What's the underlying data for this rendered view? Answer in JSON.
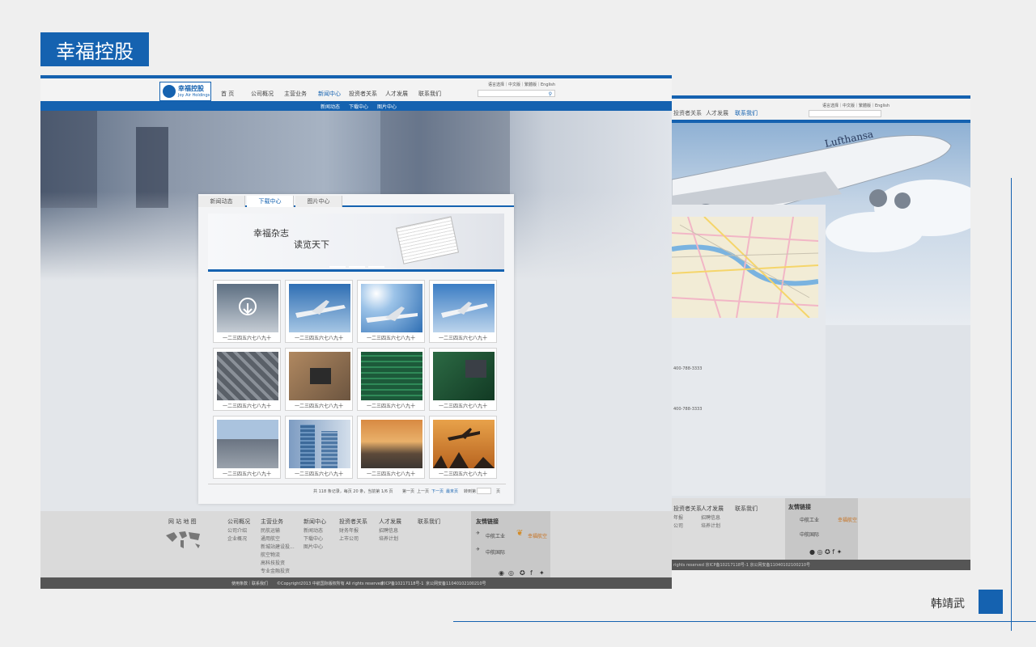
{
  "title": "幸福控股",
  "author": "韩靖武",
  "colors": {
    "accent": "#1562b0",
    "footer_dark": "#555555"
  },
  "front": {
    "logo": {
      "cn": "幸福控股",
      "en": "Joy Air Holdings"
    },
    "nav": [
      "首 页",
      "公司概况",
      "主营业务",
      "新闻中心",
      "投资者关系",
      "人才发展",
      "联系我们"
    ],
    "lang": "语言选择｜中文版｜繁體版｜English",
    "subnav": [
      "新闻动态",
      "下载中心",
      "图片中心"
    ],
    "tabs": [
      "新闻动态",
      "下载中心",
      "图片中心"
    ],
    "magazine": {
      "line1": "幸福杂志",
      "line2": "读览天下"
    },
    "cards": [
      "一二三四五六七八九十",
      "一二三四五六七八九十",
      "一二三四五六七八九十",
      "一二三四五六七八九十",
      "一二三四五六七八九十",
      "一二三四五六七八九十",
      "一二三四五六七八九十",
      "一二三四五六七八九十",
      "一二三四五六七八九十",
      "一二三四五六七八九十",
      "一二三四五六七八九十",
      "一二三四五六七八九十"
    ],
    "pager": {
      "summary": "共 118 条记录，每页 20 条，当前第 1/6 页",
      "first": "第一页",
      "prev": "上一页",
      "next": "下一页",
      "last": "最末页",
      "goto": "转到第",
      "page_suffix": "页"
    },
    "footer": {
      "sitemap": "网 站 地 图",
      "cols": [
        {
          "h": "公司概况",
          "items": [
            "公司介绍",
            "企业概况"
          ]
        },
        {
          "h": "主营业务",
          "items": [
            "民航运输",
            "通用航空",
            "新城站建设投...",
            "航空物流",
            "高科技投资",
            "专业金融投资"
          ]
        },
        {
          "h": "新闻中心",
          "items": [
            "新闻动态",
            "下载中心",
            "图片中心"
          ]
        },
        {
          "h": "投资者关系",
          "items": [
            "财务年报",
            "上市公司"
          ]
        },
        {
          "h": "人才发展",
          "items": [
            "招聘信息",
            "培养计划"
          ]
        },
        {
          "h": "联系我们",
          "items": []
        }
      ],
      "friend_title": "友情链接",
      "friends": [
        "中航工业",
        "幸福航空",
        "中航国际"
      ],
      "bottom": {
        "left": "使用条款｜联系我们",
        "copyright": "©Copyright2013 中航国际版权所有 All rights reserved",
        "icp": "京ICP备10217118号-1",
        "police": "京公网安备11040102100210号"
      }
    }
  },
  "back": {
    "nav": [
      "投资者关系",
      "人才发展",
      "联系我们"
    ],
    "lang": "语言选择｜中文版｜繁體版｜English",
    "phones": [
      "400-788-3333",
      "400-788-3333"
    ],
    "footer_cols": [
      {
        "h": "投资者关系",
        "items": [
          "年报",
          "公司"
        ]
      },
      {
        "h": "人才发展",
        "items": [
          "招聘信息",
          "培养计划"
        ]
      },
      {
        "h": "联系我们",
        "items": []
      }
    ],
    "friend_title": "友情链接",
    "friends": [
      "中航工业",
      "幸福航空",
      "中航国际"
    ],
    "bottom": "rights reserved  京ICP备10217118号-1  京公网安备11040102100210号"
  }
}
